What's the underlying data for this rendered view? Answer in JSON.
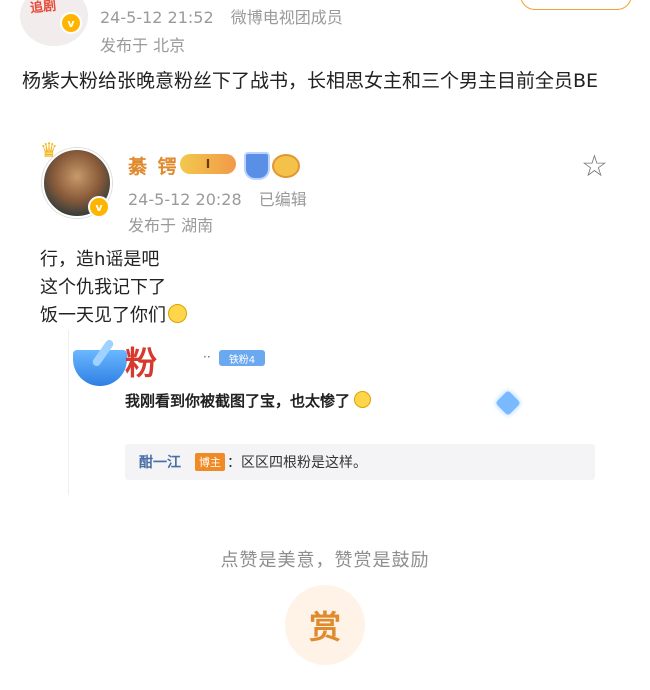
{
  "post": {
    "author_avatar_text": "追剧",
    "verified_badge": "v",
    "timestamp": "24-5-12 21:52",
    "source": "微博电视团成员",
    "location": "发布于 北京",
    "body": "杨紫大粉给张晚意粉丝下了战书，长相思女主和三个男主目前全员BE"
  },
  "embedded": {
    "name": "綦   锷",
    "level_badge": "I",
    "timestamp": "24-5-12 20:28",
    "edited": "已编辑",
    "location": "发布于 湖南",
    "lines": [
      "行，造h谣是吧",
      "这个仇我记下了",
      "饭一天见了你们"
    ],
    "quote": {
      "user_char": "粉",
      "dash": "··",
      "fan_badge": "铁粉4",
      "text": "我刚看到你被截图了宝，也太惨了",
      "reply_name": "酣一江",
      "reply_tag": "博主",
      "reply_text": "：区区四根粉是这样。"
    }
  },
  "footer": {
    "tip": "点赞是美意，赞赏是鼓励",
    "reward_label": "赏"
  },
  "colors": {
    "accent": "#e08a2e",
    "meta_gray": "#9a9a9a",
    "fan_badge_blue": "#6aa8f0"
  }
}
